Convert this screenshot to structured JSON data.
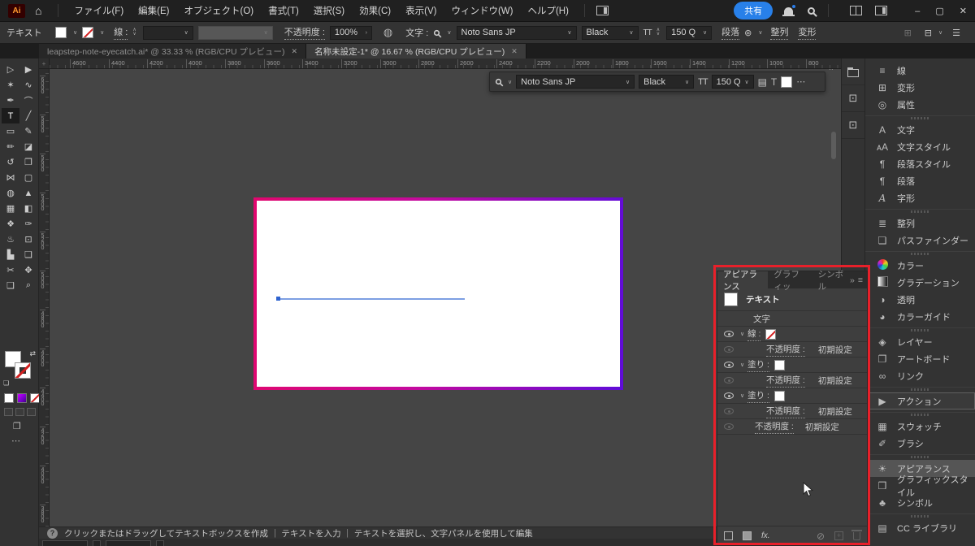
{
  "menubar": {
    "app_logo": "Ai",
    "items": [
      "ファイル(F)",
      "編集(E)",
      "オブジェクト(O)",
      "書式(T)",
      "選択(S)",
      "効果(C)",
      "表示(V)",
      "ウィンドウ(W)",
      "ヘルプ(H)"
    ],
    "share_label": "共有",
    "window_controls": {
      "minimize": "–",
      "maximize": "▢",
      "close": "✕"
    }
  },
  "controlbar": {
    "context_label": "テキスト",
    "stroke_label": "線 :",
    "opacity_label": "不透明度 :",
    "opacity_value": "100%",
    "opacity_more": "›",
    "char_label": "文字 :",
    "font_value": "Noto Sans JP",
    "weight_value": "Black",
    "size_value": "150 Q",
    "paragraph_label": "段落",
    "align_label": "整列",
    "transform_label": "変形",
    "tt_icon": "TT",
    "composer_icon": "⊛",
    "sphere_icon": "◍",
    "grid_icon": "⊞",
    "panel_icon": "⊟",
    "list_icon": "☰"
  },
  "tabs": [
    {
      "title": "leapstep-note-eyecatch.ai* @ 33.33 % (RGB/CPU プレビュー)",
      "close": "✕"
    },
    {
      "title": "名称未設定-1* @ 16.67 % (RGB/CPU プレビュー)",
      "close": "✕"
    }
  ],
  "floatbar": {
    "font_value": "Noto Sans JP",
    "weight_value": "Black",
    "size_value": "150 Q",
    "tt_icon": "TT",
    "panel_icon": "▤",
    "touch_type_icon": "T",
    "more_icon": "⋯"
  },
  "toolbar": {
    "tools": [
      {
        "name": "selection-tool",
        "glyph": "▷"
      },
      {
        "name": "direct-selection-tool",
        "glyph": "▶"
      },
      {
        "name": "magic-wand-tool",
        "glyph": "✶"
      },
      {
        "name": "lasso-tool",
        "glyph": "∿"
      },
      {
        "name": "pen-tool",
        "glyph": "✒"
      },
      {
        "name": "curvature-tool",
        "glyph": "⌒"
      },
      {
        "name": "type-tool",
        "glyph": "T"
      },
      {
        "name": "line-segment-tool",
        "glyph": "╱"
      },
      {
        "name": "rectangle-tool",
        "glyph": "▭"
      },
      {
        "name": "paintbrush-tool",
        "glyph": "✎"
      },
      {
        "name": "pencil-tool",
        "glyph": "✏"
      },
      {
        "name": "eraser-tool",
        "glyph": "◪"
      },
      {
        "name": "rotate-tool",
        "glyph": "↺"
      },
      {
        "name": "scale-tool",
        "glyph": "❐"
      },
      {
        "name": "width-tool",
        "glyph": "⋈"
      },
      {
        "name": "free-transform-tool",
        "glyph": "▢"
      },
      {
        "name": "shape-builder-tool",
        "glyph": "◍"
      },
      {
        "name": "perspective-grid-tool",
        "glyph": "▲"
      },
      {
        "name": "mesh-tool",
        "glyph": "▦"
      },
      {
        "name": "gradient-tool",
        "glyph": "◧"
      },
      {
        "name": "blend-tool",
        "glyph": "❖"
      },
      {
        "name": "eyedropper-tool",
        "glyph": "✑"
      },
      {
        "name": "symbol-sprayer-tool",
        "glyph": "♨"
      },
      {
        "name": "graph-tool",
        "glyph": "⊡"
      },
      {
        "name": "column-graph-tool",
        "glyph": "▙"
      },
      {
        "name": "artboard-tool",
        "glyph": "❏"
      },
      {
        "name": "slice-tool",
        "glyph": "✂"
      },
      {
        "name": "hand-tool",
        "glyph": "✥"
      },
      {
        "name": "print-tiling-tool",
        "glyph": "❑"
      },
      {
        "name": "zoom-tool",
        "glyph": "⌕"
      }
    ],
    "more_icon": "⋯"
  },
  "ruler": {
    "h_labels": [
      "4600",
      "4400",
      "4200",
      "4000",
      "3800",
      "3600",
      "3400",
      "3200",
      "3000",
      "2800",
      "2600",
      "2400",
      "2200",
      "2000",
      "1800",
      "1600",
      "1400",
      "1200",
      "1000",
      "800"
    ],
    "v_labels": [
      "6000",
      "5800",
      "5600",
      "5400",
      "5200",
      "5000",
      "4800",
      "4600",
      "4400",
      "4200",
      "4000",
      "3800"
    ]
  },
  "appearance": {
    "tabs": {
      "t1": "アピアランス",
      "t2": "グラフィッ",
      "t3": "シンボル",
      "overflow": "»",
      "menu": "≡"
    },
    "rows": [
      {
        "label": "テキスト"
      },
      {
        "label": "文字"
      },
      {
        "label": "線 :"
      },
      {
        "label": "不透明度 :",
        "value": "初期設定"
      },
      {
        "label": "塗り :"
      },
      {
        "label": "不透明度 :",
        "value": "初期設定"
      },
      {
        "label": "塗り :"
      },
      {
        "label": "不透明度 :",
        "value": "初期設定"
      },
      {
        "label": "不透明度 :",
        "value": "初期設定"
      }
    ],
    "footer": {
      "fx_label": "fx.",
      "clear_icon": "⊘",
      "plus_icon": "+"
    }
  },
  "rightdock": {
    "items": [
      {
        "label": "線",
        "glyph": "≡"
      },
      {
        "label": "変形",
        "glyph": "⊞"
      },
      {
        "label": "属性",
        "glyph": "◎"
      },
      {
        "label": "文字",
        "glyph": "A"
      },
      {
        "label": "文字スタイル",
        "glyph": "ᴀA"
      },
      {
        "label": "段落スタイル",
        "glyph": "¶"
      },
      {
        "label": "段落",
        "glyph": "¶"
      },
      {
        "label": "字形",
        "glyph": "A"
      },
      {
        "label": "整列",
        "glyph": "≣"
      },
      {
        "label": "パスファインダー",
        "glyph": "❏"
      },
      {
        "label": "カラー",
        "glyph": ""
      },
      {
        "label": "グラデーション",
        "glyph": ""
      },
      {
        "label": "透明",
        "glyph": "◑"
      },
      {
        "label": "カラーガイド",
        "glyph": "◕"
      },
      {
        "label": "レイヤー",
        "glyph": "◈"
      },
      {
        "label": "アートボード",
        "glyph": "❐"
      },
      {
        "label": "リンク",
        "glyph": "∞"
      },
      {
        "label": "アクション",
        "glyph": "▶"
      },
      {
        "label": "スウォッチ",
        "glyph": "▦"
      },
      {
        "label": "ブラシ",
        "glyph": "✐"
      },
      {
        "label": "アピアランス",
        "glyph": "☀"
      },
      {
        "label": "グラフィックスタイル",
        "glyph": "❒"
      },
      {
        "label": "シンボル",
        "glyph": "♣"
      },
      {
        "label": "CC ライブラリ",
        "glyph": "▤"
      }
    ]
  },
  "statusbar": {
    "help_icon": "?",
    "text": "クリックまたはドラッグしてテキストボックスを作成 ｜ テキストを入力 ｜ テキストを選択し、文字パネルを使用して編集"
  },
  "colors": {
    "accent_blue": "#2880e9",
    "annotation_red": "#e8202a",
    "selection_blue": "#7d9fe3",
    "artboard_gradient_start": "#e0076e",
    "artboard_gradient_end": "#5f0cd9"
  }
}
